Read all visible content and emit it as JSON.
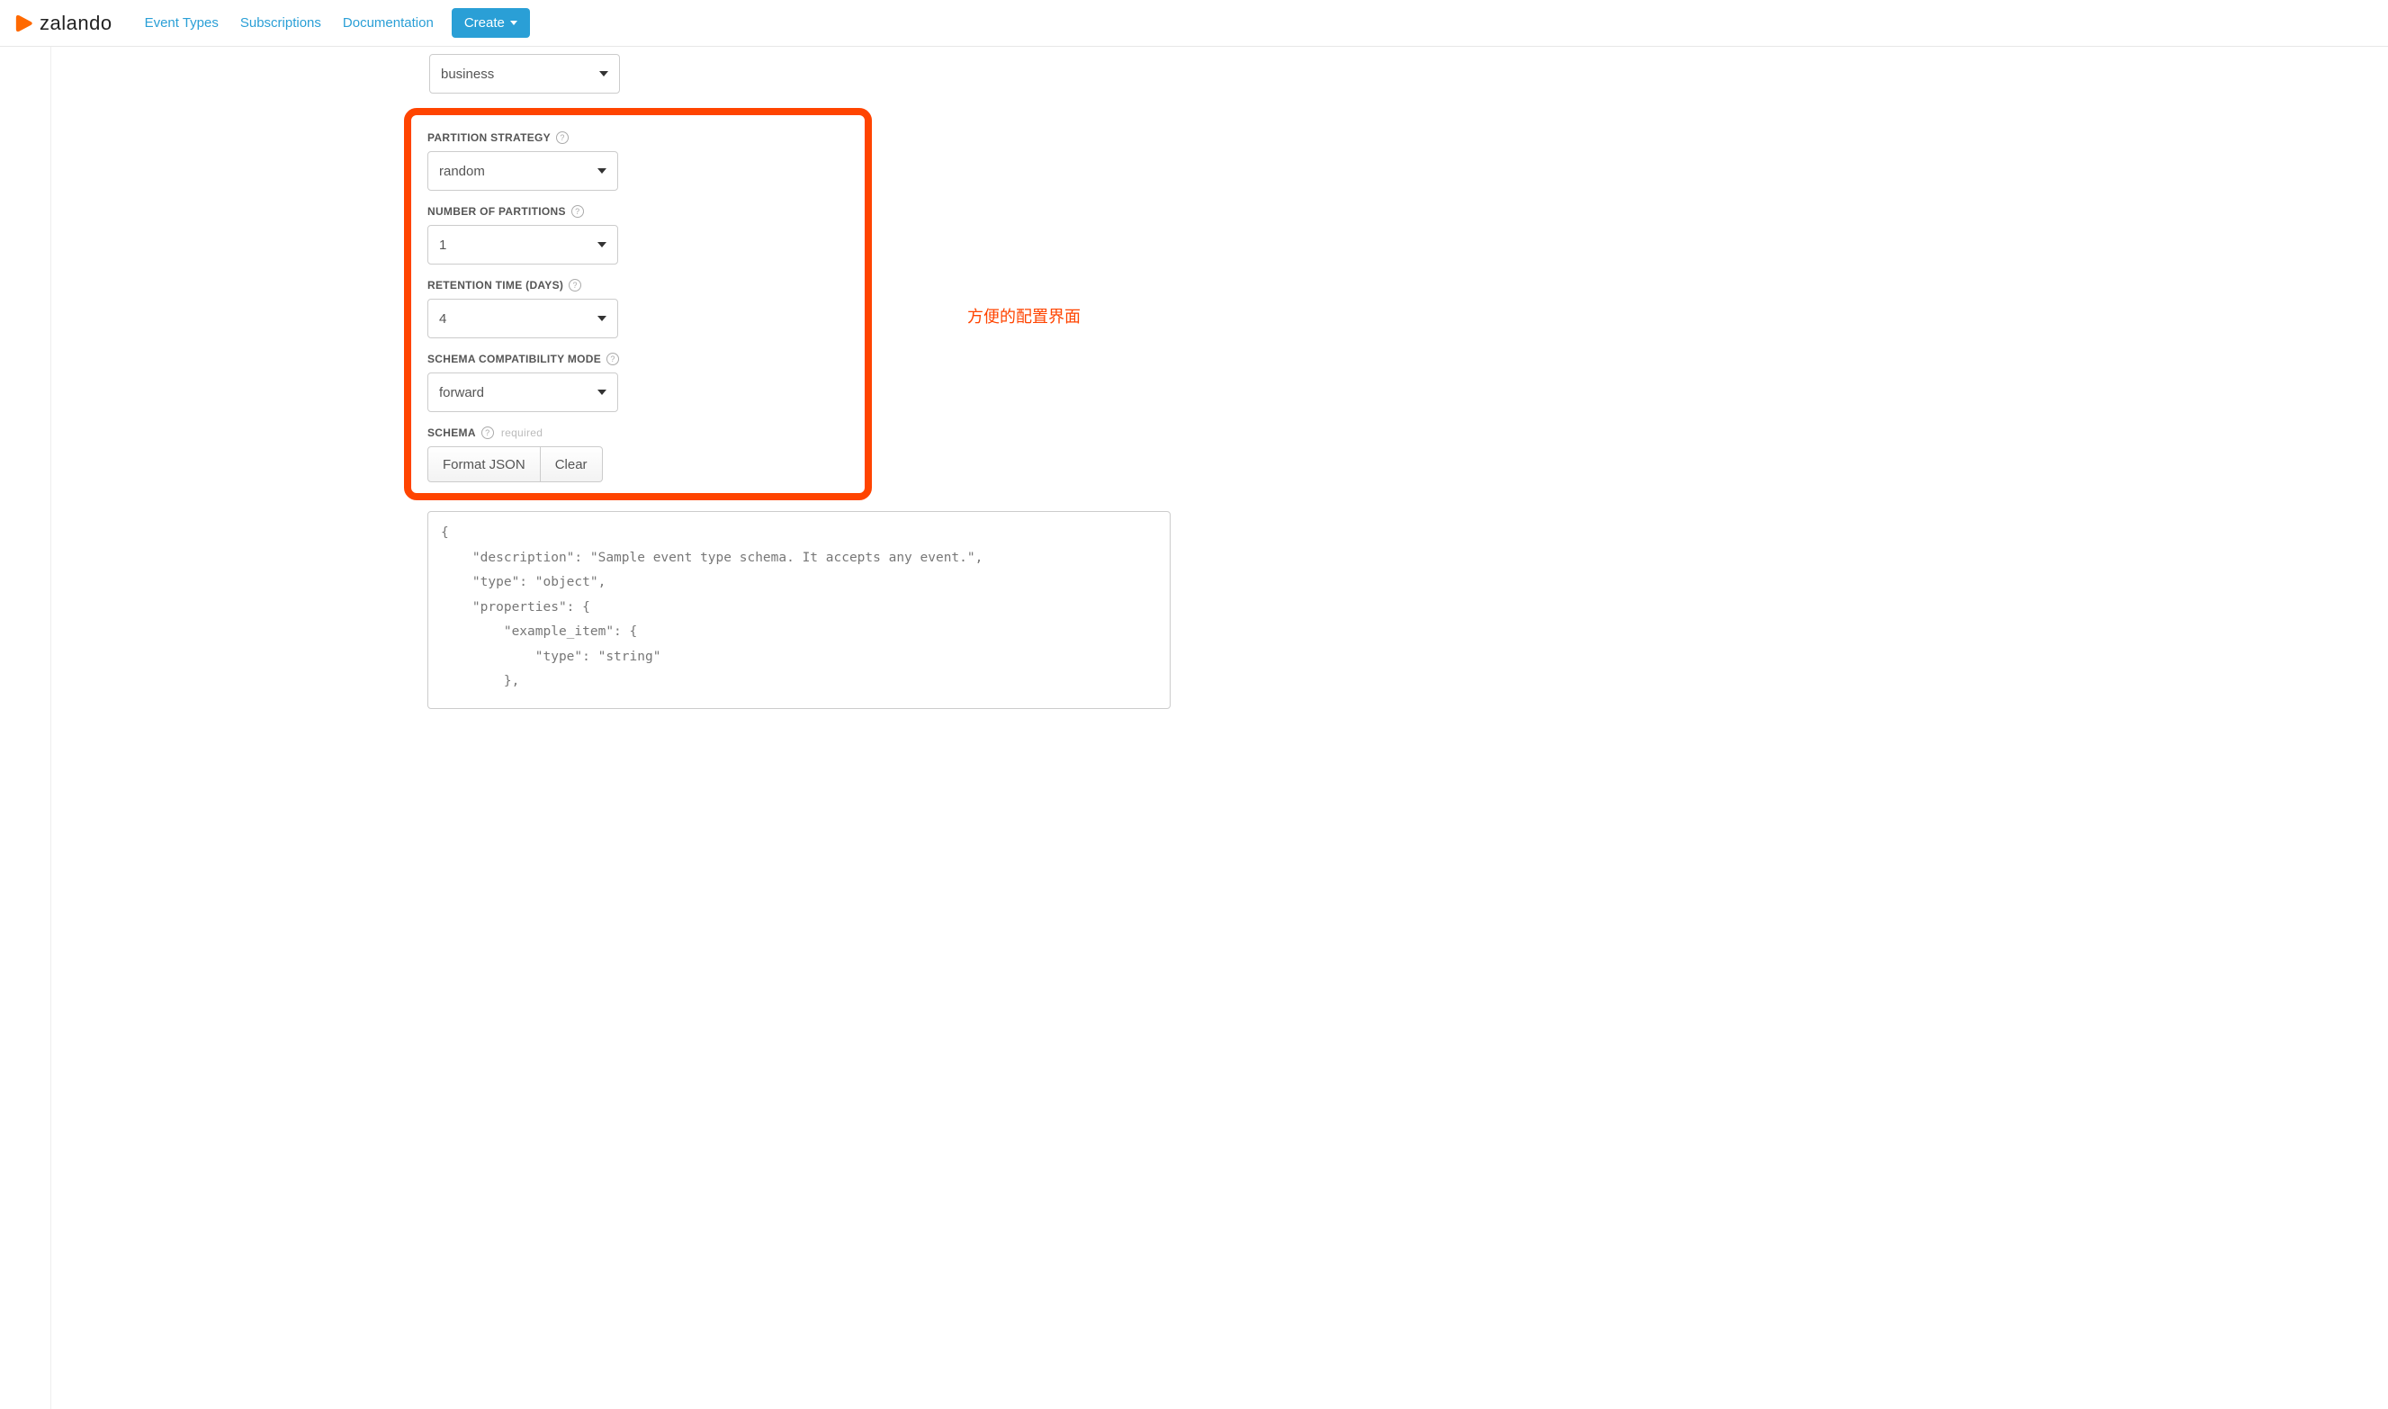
{
  "brand": {
    "name": "zalando"
  },
  "nav": {
    "links": [
      "Event Types",
      "Subscriptions",
      "Documentation"
    ],
    "create_label": "Create"
  },
  "annotation": "方便的配置界面",
  "form": {
    "category": {
      "value": "business"
    },
    "partition_strategy": {
      "label": "PARTITION STRATEGY",
      "value": "random"
    },
    "number_of_partitions": {
      "label": "NUMBER OF PARTITIONS",
      "value": "1"
    },
    "retention_time": {
      "label": "RETENTION TIME (DAYS)",
      "value": "4"
    },
    "schema_compat": {
      "label": "SCHEMA COMPATIBILITY MODE",
      "value": "forward"
    },
    "schema": {
      "label": "SCHEMA",
      "required_tag": "required",
      "format_btn": "Format JSON",
      "clear_btn": "Clear",
      "value": "{\n    \"description\": \"Sample event type schema. It accepts any event.\",\n    \"type\": \"object\",\n    \"properties\": {\n        \"example_item\": {\n            \"type\": \"string\"\n        },"
    }
  }
}
